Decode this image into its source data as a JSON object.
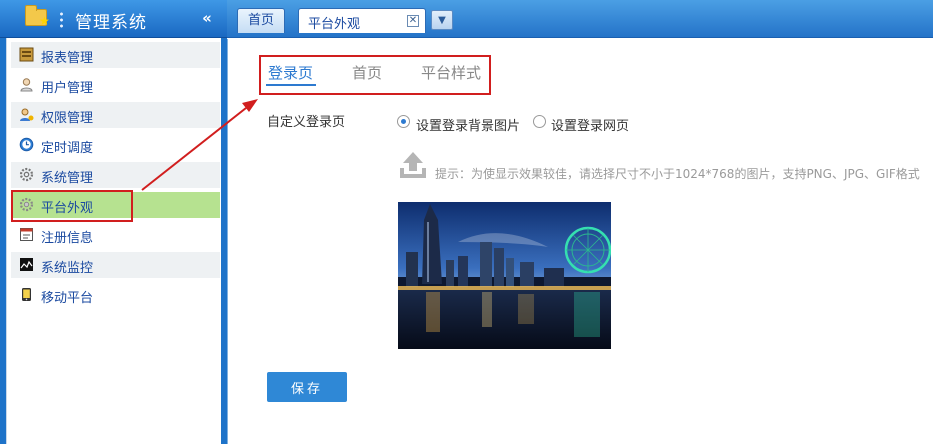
{
  "sidebar": {
    "title": "管理系统",
    "collapse_icon": "double-chevron-left-icon",
    "items": [
      {
        "label": "报表管理",
        "icon": "report-icon"
      },
      {
        "label": "用户管理",
        "icon": "user-icon"
      },
      {
        "label": "权限管理",
        "icon": "permission-icon"
      },
      {
        "label": "定时调度",
        "icon": "clock-icon"
      },
      {
        "label": "系统管理",
        "icon": "gear-icon"
      },
      {
        "label": "平台外观",
        "icon": "appearance-icon"
      },
      {
        "label": "注册信息",
        "icon": "register-icon"
      },
      {
        "label": "系统监控",
        "icon": "monitor-icon"
      },
      {
        "label": "移动平台",
        "icon": "mobile-icon"
      }
    ],
    "active_item": "平台外观"
  },
  "tabbar": {
    "home_tab": "首页",
    "active_tab": "平台外观",
    "close_icon": "close-icon",
    "more_icon": "dropdown-arrow-icon"
  },
  "content": {
    "subtabs": [
      "登录页",
      "首页",
      "平台样式"
    ],
    "active_subtab": "登录页",
    "field_label": "自定义登录页",
    "radio_options": [
      {
        "label": "设置登录背景图片",
        "checked": true
      },
      {
        "label": "设置登录网页",
        "checked": false
      }
    ],
    "upload_icon": "upload-icon",
    "hint": "提示：为使显示效果较佳，请选择尺寸不小于1024*768的图片，支持PNG、JPG、GIF格式",
    "save_label": "保存"
  },
  "colors": {
    "sidebar_blue": "#1e73c9",
    "active_menu_green": "#b6e290",
    "accent_blue": "#2d7ad0",
    "annotation_red": "#d11e1e",
    "save_button": "#2f88d6"
  }
}
